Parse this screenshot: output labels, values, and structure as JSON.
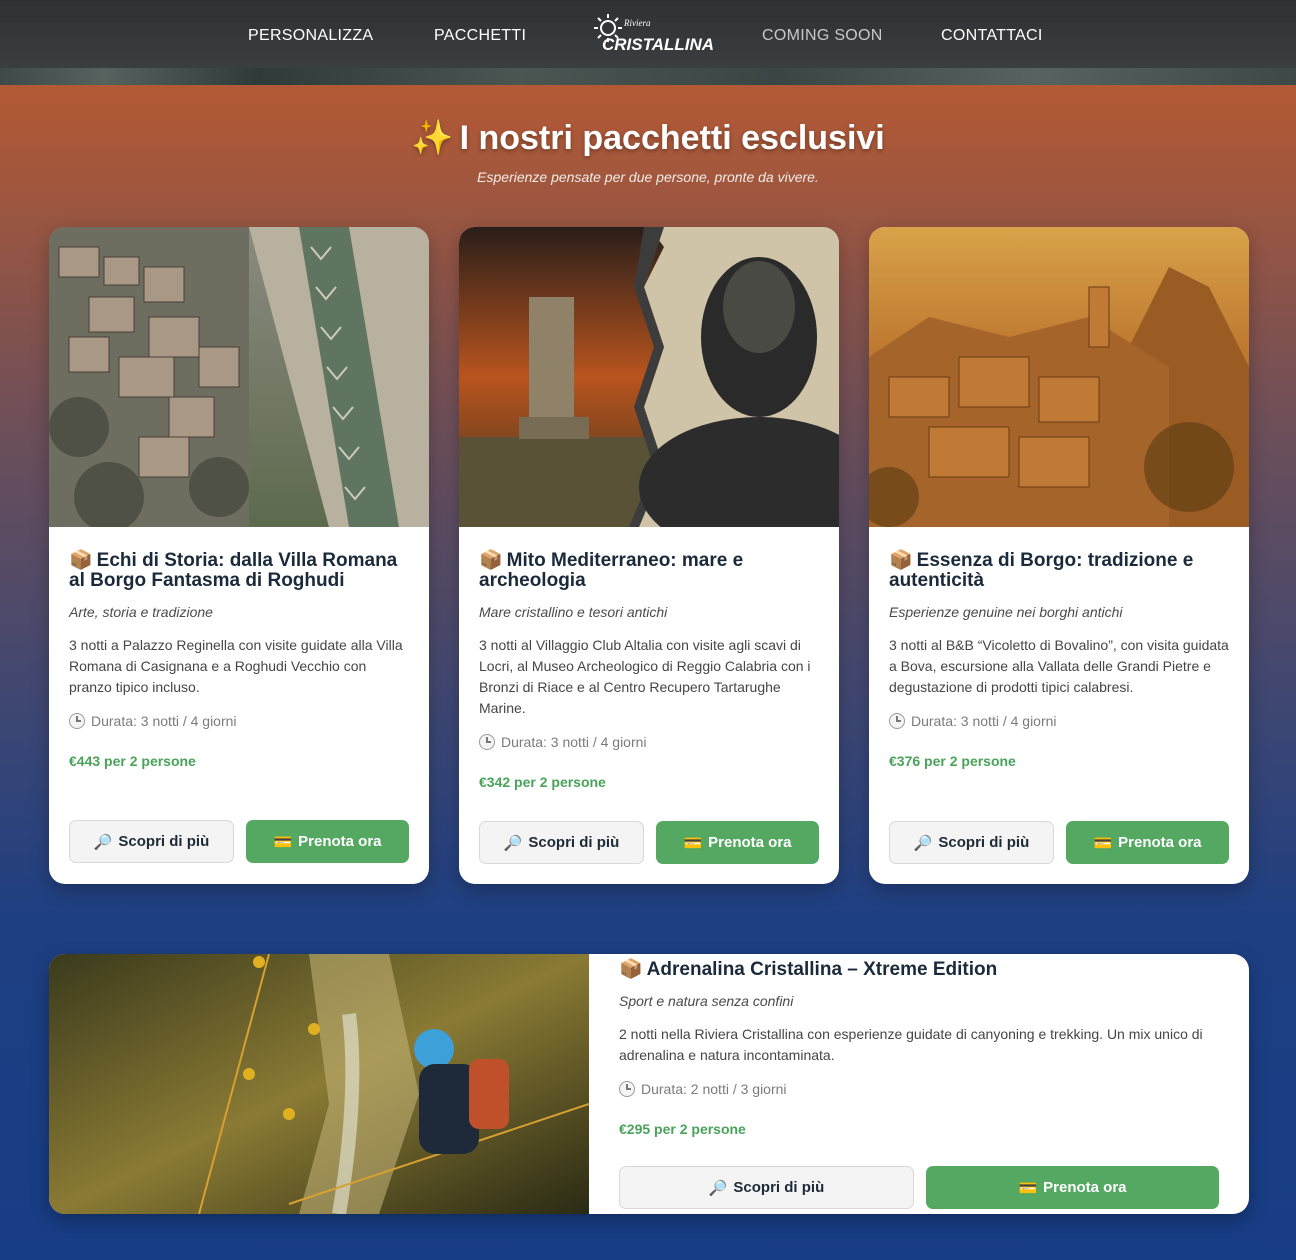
{
  "nav": {
    "items": [
      {
        "label": "PERSONALIZZA"
      },
      {
        "label": "PACCHETTI"
      },
      {
        "label": "COMING SOON"
      },
      {
        "label": "CONTATTACI"
      }
    ],
    "logo_small": "Riviera",
    "logo_main": "CRISTALLINA"
  },
  "header": {
    "icon": "✨",
    "title": "I nostri pacchetti esclusivi",
    "subtitle": "Esperienze pensate per due persone, pronte da vivere."
  },
  "buttons": {
    "more_icon": "🔎",
    "more_label": "Scopri di più",
    "book_icon": "💳",
    "book_label": "Prenota ora"
  },
  "package_icon": "📦",
  "packages": [
    {
      "title": "Echi di Storia: dalla Villa Romana al Borgo Fantasma di Roghudi",
      "subtitle": "Arte, storia e tradizione",
      "description": "3 notti a Palazzo Reginella con visite guidate alla Villa Romana di Casignana e a Roghudi Vecchio con pranzo tipico incluso.",
      "duration": "Durata: 3 notti / 4 giorni",
      "price": "€443 per 2 persone"
    },
    {
      "title": "Mito Mediterraneo: mare e archeologia",
      "subtitle": "Mare cristallino e tesori antichi",
      "description": "3 notti al Villaggio Club Altalia con visite agli scavi di Locri, al Museo Archeologico di Reggio Calabria con i Bronzi di Riace e al Centro Recupero Tartarughe Marine.",
      "duration": "Durata: 3 notti / 4 giorni",
      "price": "€342 per 2 persone"
    },
    {
      "title": "Essenza di Borgo: tradizione e autenticità",
      "subtitle": "Esperienze genuine nei borghi antichi",
      "description": "3 notti al B&B “Vicoletto di Bovalino”, con visita guidata a Bova, escursione alla Vallata delle Grandi Pietre e degustazione di prodotti tipici calabresi.",
      "duration": "Durata: 3 notti / 4 giorni",
      "price": "€376 per 2 persone"
    },
    {
      "title": "Adrenalina Cristallina – Xtreme Edition",
      "subtitle": "Sport e natura senza confini",
      "description": "2 notti nella Riviera Cristallina con esperienze guidate di canyoning e trekking. Un mix unico di adrenalina e natura incontaminata.",
      "duration": "Durata: 2 notti / 3 giorni",
      "price": "€295 per 2 persone"
    }
  ]
}
